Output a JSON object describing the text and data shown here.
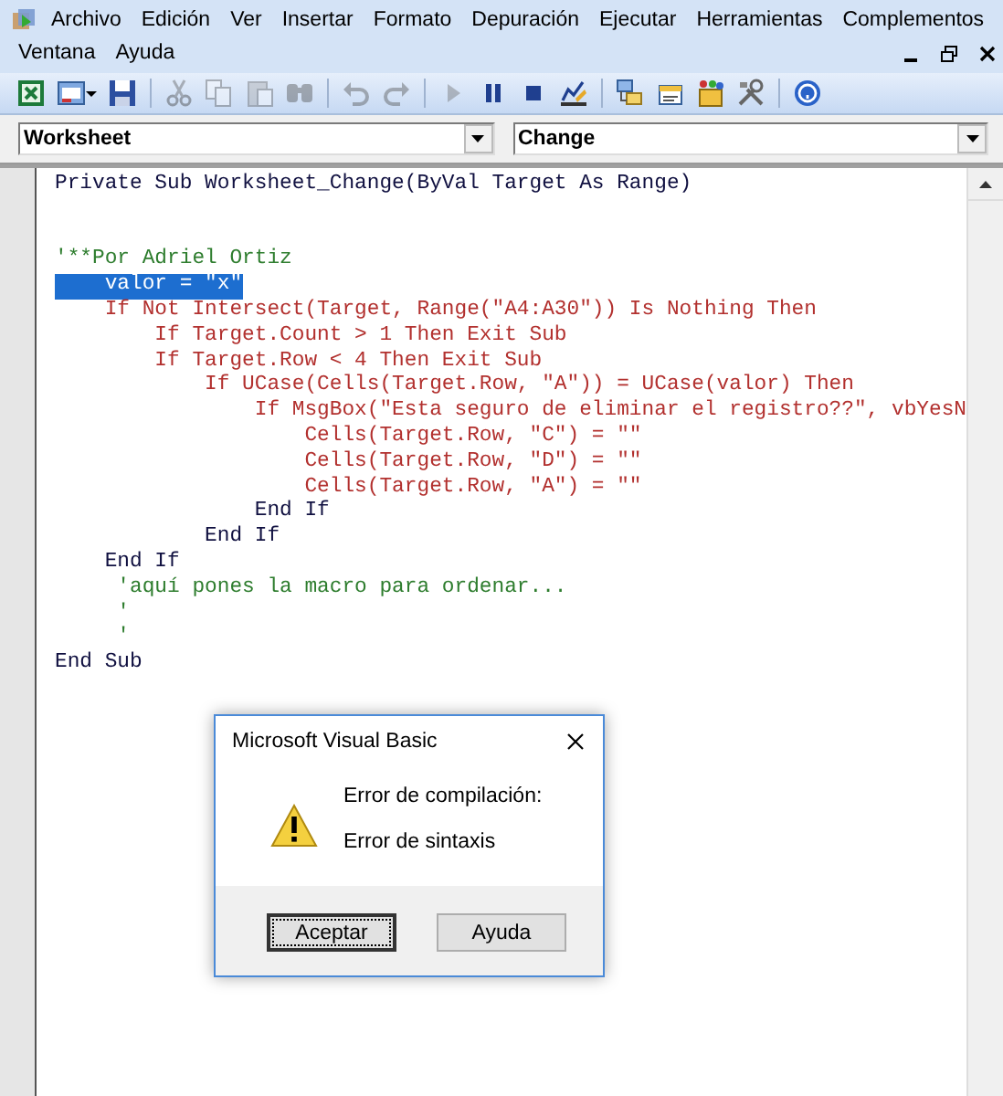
{
  "menu_rows": [
    [
      "Archivo",
      "Edición",
      "Ver",
      "Insertar",
      "Formato",
      "Depuración",
      "Ejecutar",
      "Herramientas",
      "Complementos"
    ],
    [
      "Ventana",
      "Ayuda"
    ]
  ],
  "toolbar": {
    "groups": [
      [
        {
          "kind": "excel",
          "disabled": false
        },
        {
          "kind": "userform",
          "disabled": false
        },
        {
          "kind": "save",
          "disabled": false
        }
      ],
      [
        {
          "kind": "cut",
          "disabled": true
        },
        {
          "kind": "copy",
          "disabled": true
        },
        {
          "kind": "paste",
          "disabled": true
        },
        {
          "kind": "find",
          "disabled": true
        }
      ],
      [
        {
          "kind": "undo",
          "disabled": true
        },
        {
          "kind": "redo",
          "disabled": true
        }
      ],
      [
        {
          "kind": "run",
          "disabled": true
        },
        {
          "kind": "pause",
          "disabled": false
        },
        {
          "kind": "stop",
          "disabled": false
        },
        {
          "kind": "design",
          "disabled": false
        }
      ],
      [
        {
          "kind": "project",
          "disabled": false
        },
        {
          "kind": "properties",
          "disabled": false
        },
        {
          "kind": "browser",
          "disabled": false
        },
        {
          "kind": "toolbox",
          "disabled": false
        }
      ],
      [
        {
          "kind": "help",
          "disabled": false
        }
      ]
    ]
  },
  "object_combo": {
    "value": "Worksheet"
  },
  "procedure_combo": {
    "value": "Change"
  },
  "code": {
    "lines": [
      {
        "kind": "code",
        "text": "Private Sub Worksheet_Change(ByVal Target As Range)",
        "selected": false
      },
      {
        "kind": "blank",
        "selected": false
      },
      {
        "kind": "blank",
        "selected": false
      },
      {
        "kind": "comment",
        "text": "'**Por Adriel Ortiz",
        "selected": false
      },
      {
        "kind": "error",
        "text": "    valor = \"x\"",
        "selected": true
      },
      {
        "kind": "error",
        "text": "    If Not Intersect(Target, Range(\"A4:A30\")) Is Nothing Then",
        "selected": false
      },
      {
        "kind": "error",
        "text": "        If Target.Count > 1 Then Exit Sub",
        "selected": false
      },
      {
        "kind": "error",
        "text": "        If Target.Row < 4 Then Exit Sub",
        "selected": false
      },
      {
        "kind": "error",
        "text": "            If UCase(Cells(Target.Row, \"A\")) = UCase(valor) Then",
        "selected": false
      },
      {
        "kind": "error",
        "text": "                If MsgBox(\"Esta seguro de eliminar el registro??\", vbYesN",
        "selected": false
      },
      {
        "kind": "error",
        "text": "                    Cells(Target.Row, \"C\") = \"\"",
        "selected": false
      },
      {
        "kind": "error",
        "text": "                    Cells(Target.Row, \"D\") = \"\"",
        "selected": false
      },
      {
        "kind": "error",
        "text": "                    Cells(Target.Row, \"A\") = \"\"",
        "selected": false
      },
      {
        "kind": "code",
        "text": "                End If",
        "selected": false
      },
      {
        "kind": "code",
        "text": "            End If",
        "selected": false
      },
      {
        "kind": "code",
        "text": "    End If",
        "selected": false
      },
      {
        "kind": "comment",
        "text": "     'aquí pones la macro para ordenar...",
        "selected": false
      },
      {
        "kind": "comment",
        "text": "     '",
        "selected": false
      },
      {
        "kind": "comment",
        "text": "     '",
        "selected": false
      },
      {
        "kind": "code",
        "text": "End Sub",
        "selected": false
      }
    ]
  },
  "dialog": {
    "title": "Microsoft Visual Basic",
    "heading": "Error de compilación:",
    "message": "Error de sintaxis",
    "buttons": [
      {
        "label": "Aceptar",
        "default": true
      },
      {
        "label": "Ayuda",
        "default": false
      }
    ]
  }
}
